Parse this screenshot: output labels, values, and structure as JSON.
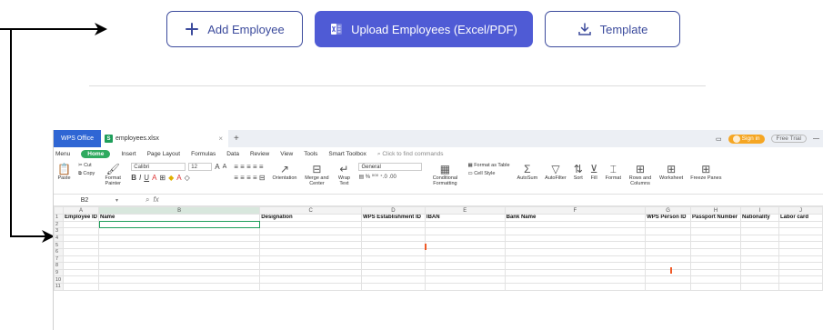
{
  "actions": {
    "add_employee": "Add Employee",
    "upload_employees": "Upload Employees (Excel/PDF)",
    "template": "Template"
  },
  "colors": {
    "primary": "#4f5bd5",
    "outline": "#3b4a9c",
    "wps_blue": "#2f66d4",
    "home_green": "#2faa5f",
    "signin_orange": "#f5a623",
    "marker": "#f05a28"
  },
  "spreadsheet": {
    "app_tab": "WPS Office",
    "file_icon": "S",
    "file_name": "employees.xlsx",
    "new_tab": "+",
    "sign_in": "Sign in",
    "free_trial": "Free Trial",
    "menu": [
      "Menu",
      "Home",
      "Insert",
      "Page Layout",
      "Formulas",
      "Data",
      "Review",
      "View",
      "Tools",
      "Smart Toolbox"
    ],
    "command_search": "Click to find commands",
    "ribbon": {
      "paste": "Paste",
      "cut": "Cut",
      "copy": "Copy",
      "format_painter": "Format Painter",
      "font_name": "Calibri",
      "font_size": "12",
      "orientation": "Orientation",
      "merge_center": "Merge and Center",
      "wrap_text": "Wrap Text",
      "number_format": "General",
      "conditional_formatting": "Conditional Formatting",
      "format_as_table": "Format as Table",
      "cell_style": "Cell Style",
      "autosum": "AutoSum",
      "autofilter": "AutoFilter",
      "sort": "Sort",
      "fill": "Fill",
      "format": "Format",
      "rows_columns": "Rows and Columns",
      "worksheet": "Worksheet",
      "freeze_panes": "Freeze Panes"
    },
    "name_box": "B2",
    "fx_label": "fx",
    "columns": [
      "A",
      "B",
      "C",
      "D",
      "E",
      "F",
      "G",
      "H",
      "I",
      "J"
    ],
    "header_row": [
      "Employee ID",
      "Name",
      "Designation",
      "WPS Establishment ID",
      "IBAN",
      "Bank Name",
      "WPS Person ID",
      "Passport Number",
      "Nationality",
      "Labor card"
    ],
    "row_numbers": [
      "1",
      "2",
      "3",
      "4",
      "5",
      "6",
      "7",
      "8",
      "9",
      "10",
      "11"
    ]
  }
}
